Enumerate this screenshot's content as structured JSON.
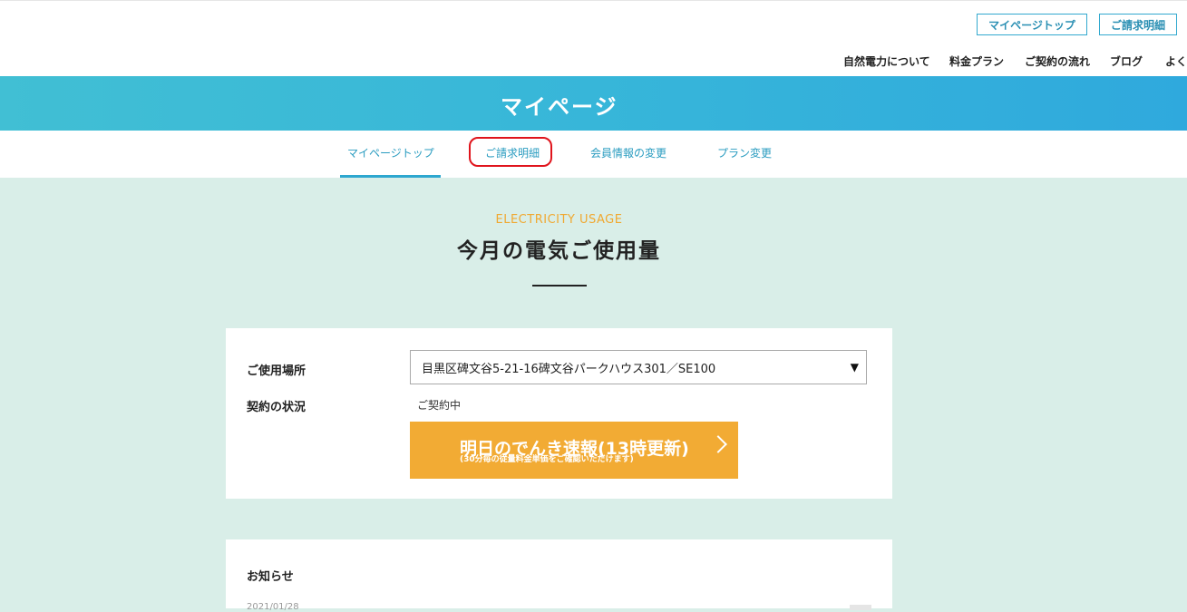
{
  "header": {
    "buttons": [
      "マイページトップ",
      "ご請求明細"
    ],
    "nav": [
      "自然電力について",
      "料金プラン",
      "ご契約の流れ",
      "ブログ",
      "よく"
    ]
  },
  "hero": {
    "title": "マイページ"
  },
  "tabs": [
    "マイページトップ",
    "ご請求明細",
    "会員情報の変更",
    "プラン変更"
  ],
  "active_tab": "マイページトップ",
  "highlighted_tab": "ご請求明細",
  "section": {
    "eyebrow": "ELECTRICITY USAGE",
    "title": "今月の電気ご使用量"
  },
  "usage_card": {
    "location_label": "ご使用場所",
    "location_value": "目黒区碑文谷5-21-16碑文谷パークハウス301／SE100",
    "status_label": "契約の状況",
    "status_value": "ご契約中",
    "cta_main": "明日のでんき速報(13時更新)",
    "cta_sub": "(30分毎の従量料金単価をご確認いただけます)"
  },
  "news": {
    "title": "お知らせ",
    "date": "2021/01/28"
  },
  "colors": {
    "accent": "#33a9cf",
    "cta": "#f2ab34",
    "eyebrow": "#f0a830",
    "background": "#d9eee8",
    "highlight": "#e0141c"
  }
}
